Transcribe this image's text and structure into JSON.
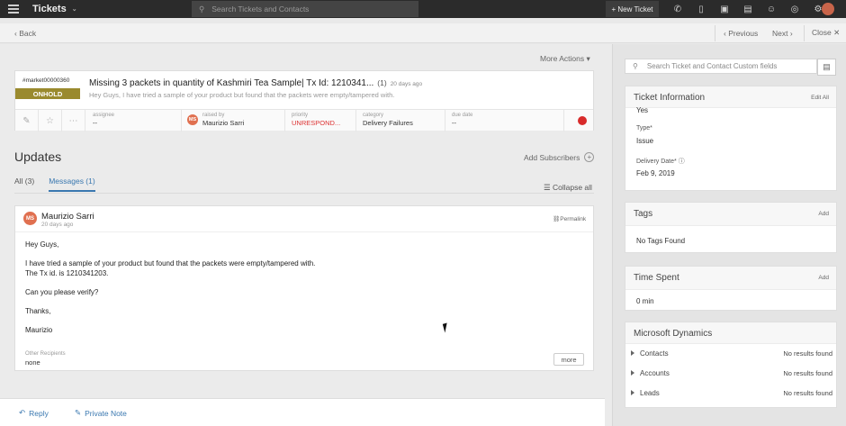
{
  "topbar": {
    "app_title": "Tickets",
    "search_placeholder": "Search Tickets and Contacts",
    "new_ticket_label": "+ New Ticket"
  },
  "subbar": {
    "back_label": "Back",
    "previous_label": "Previous",
    "next_label": "Next",
    "close_label": "Close"
  },
  "main": {
    "more_actions_label": "More Actions",
    "ticket": {
      "id": "#market00000360",
      "status": "ONHOLD",
      "subject": "Missing 3 packets in quantity of Kashmiri Tea Sample| Tx Id: 1210341...",
      "thread_count": "(1)",
      "age": "20 days ago",
      "preview": "Hey Guys, I have tried a sample of your product but found that the packets were empty/tampered with.",
      "assignee_label": "assignee",
      "assignee_value": "--",
      "raised_by_label": "raised by",
      "raised_by_value": "Maurizio Sarri",
      "raised_by_initials": "MS",
      "priority_label": "priority",
      "priority_value": "UNRESPOND...",
      "category_label": "category",
      "category_value": "Delivery Failures",
      "due_date_label": "due date",
      "due_date_value": "--",
      "status_color": "#d82b2b"
    },
    "updates_title": "Updates",
    "add_subscribers_label": "Add Subscribers",
    "tabs": [
      {
        "label": "All (3)"
      },
      {
        "label": "Messages (1)"
      }
    ],
    "collapse_all_label": "Collapse all",
    "message": {
      "author_initials": "MS",
      "author": "Maurizio Sarri",
      "age": "20 days ago",
      "permalink_label": "Permalink",
      "line1": "Hey Guys,",
      "line2": "I have tried a sample of your product but found that the packets were empty/tampered with.",
      "line3": "The Tx id. is 1210341203.",
      "line4": "Can you please verify?",
      "line5": "Thanks,",
      "line6": "Maurizio",
      "other_recipients_label": "Other Recipients",
      "other_recipients_value": "none",
      "more_label": "more"
    },
    "reply_label": "Reply",
    "private_note_label": "Private Note"
  },
  "right": {
    "search_placeholder": "Search Ticket and Contact Custom fields",
    "ticket_info": {
      "title": "Ticket Information",
      "edit_label": "Edit All",
      "cut_value": "Yes",
      "type_label": "Type*",
      "type_value": "Issue",
      "delivery_label": "Delivery Date*",
      "delivery_value": "Feb 9, 2019"
    },
    "tags": {
      "title": "Tags",
      "add_label": "Add",
      "empty": "No Tags Found"
    },
    "time_spent": {
      "title": "Time Spent",
      "add_label": "Add",
      "value": "0 min"
    },
    "dynamics": {
      "title": "Microsoft Dynamics",
      "rows": [
        {
          "label": "Contacts",
          "result": "No results found"
        },
        {
          "label": "Accounts",
          "result": "No results found"
        },
        {
          "label": "Leads",
          "result": "No results found"
        }
      ]
    }
  },
  "colors": {
    "onhold": "#9a8a2e",
    "accent": "#3a78b0",
    "avatar": "#e07050"
  }
}
